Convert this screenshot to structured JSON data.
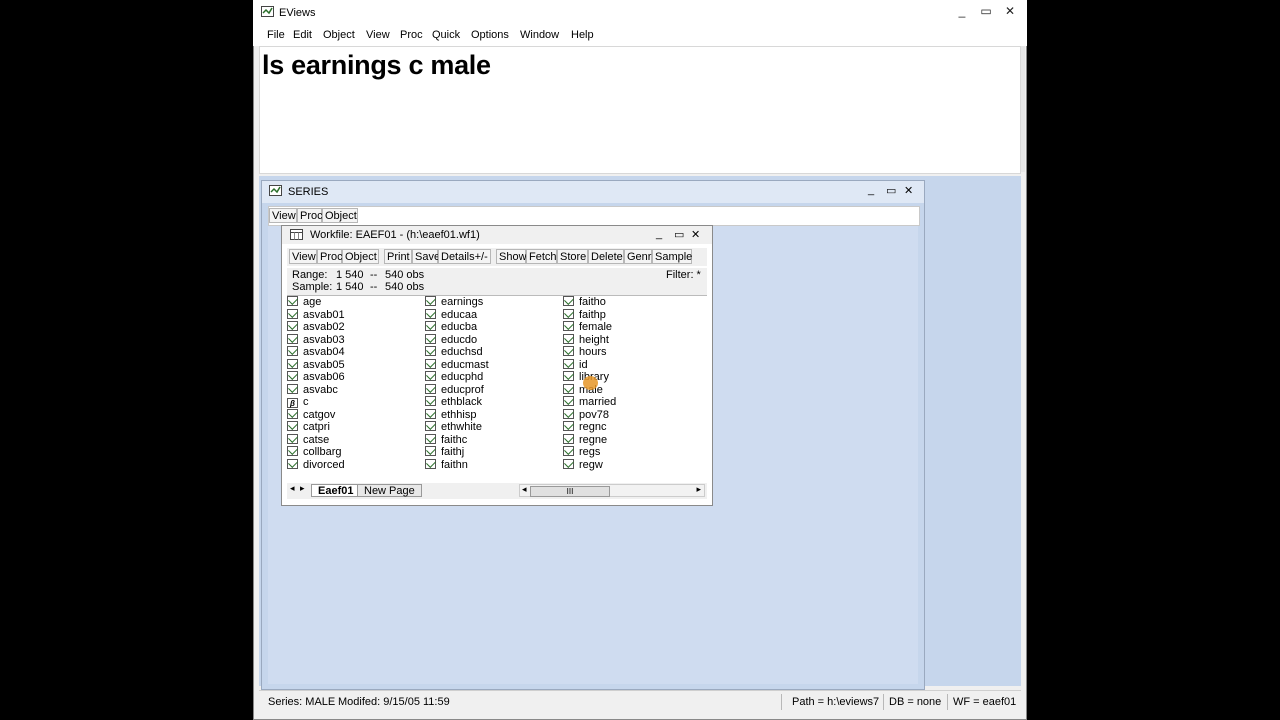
{
  "app": {
    "title": "EViews",
    "window_controls": [
      "_",
      "▭",
      "✕"
    ],
    "menu": [
      "File",
      "Edit",
      "Object",
      "View",
      "Proc",
      "Quick",
      "Options",
      "Window",
      "Help"
    ],
    "command_text": "ls earnings c male"
  },
  "series_window": {
    "title": "SERIES",
    "controls": [
      "_",
      "▭",
      "✕"
    ],
    "toolbar": [
      "View",
      "Proc",
      "Object"
    ]
  },
  "workfile": {
    "title": "Workfile: EAEF01 - (h:\\eaef01.wf1)",
    "controls": [
      "_",
      "▭",
      "✕"
    ],
    "toolbar": [
      "View",
      "Proc",
      "Object",
      "Print",
      "Save",
      "Details+/-",
      "Show",
      "Fetch",
      "Store",
      "Delete",
      "Genr",
      "Sample"
    ],
    "range_label": "Range:",
    "range_value": "1 540",
    "range_arrow": "--",
    "range_obs": "540 obs",
    "sample_label": "Sample:",
    "sample_value": "1 540",
    "sample_arrow": "--",
    "sample_obs": "540 obs",
    "filter": "Filter: *",
    "columns": [
      [
        "age",
        "asvab01",
        "asvab02",
        "asvab03",
        "asvab04",
        "asvab05",
        "asvab06",
        "asvabc",
        "c",
        "catgov",
        "catpri",
        "catse",
        "collbarg",
        "divorced"
      ],
      [
        "earnings",
        "educaa",
        "educba",
        "educdo",
        "educhsd",
        "educmast",
        "educphd",
        "educprof",
        "ethblack",
        "ethhisp",
        "ethwhite",
        "faithc",
        "faithj",
        "faithn"
      ],
      [
        "faitho",
        "faithp",
        "female",
        "height",
        "hours",
        "id",
        "library",
        "male",
        "married",
        "pov78",
        "regnc",
        "regne",
        "regs",
        "regw"
      ]
    ],
    "coef_item": "c",
    "tabs": [
      "Eaef01",
      "New Page"
    ],
    "scroll_thumb": "III"
  },
  "status": {
    "series": "Series: MALE",
    "modified": "Modifed: 9/15/05 11:59",
    "path": "Path = h:\\eviews7",
    "db": "DB = none",
    "wf": "WF = eaef01"
  }
}
